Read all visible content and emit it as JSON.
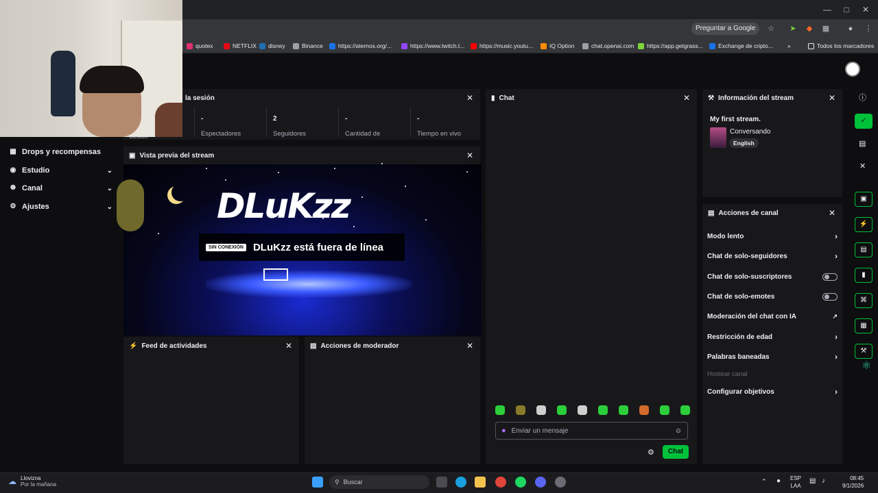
{
  "browser": {
    "ask_google": "Preguntar a Google",
    "bookmarks": [
      {
        "label": "quotex",
        "color": "#e1306c"
      },
      {
        "label": "NETFLIX",
        "color": "#e50914"
      },
      {
        "label": "disney",
        "color": "#1f6fb2"
      },
      {
        "label": "Binance",
        "color": "#9aa0a6"
      },
      {
        "label": "https://aternos.org/...",
        "color": "#1a73e8"
      },
      {
        "label": "https://www.twitch.t...",
        "color": "#9146ff"
      },
      {
        "label": "https://music.youtu...",
        "color": "#ff0000"
      },
      {
        "label": "IQ Option",
        "color": "#ff8c00"
      },
      {
        "label": "chat.openai.com",
        "color": "#9aa0a6"
      },
      {
        "label": "https://app.getgrass...",
        "color": "#7cd53b"
      },
      {
        "label": "Exchange de cripto...",
        "color": "#1a73e8"
      }
    ],
    "all_bookmarks": "Todos los marcadores"
  },
  "sidebar": {
    "items": [
      {
        "label": "Drops y recompensas",
        "icon": "gift-icon"
      },
      {
        "label": "Estudio",
        "icon": "studio-icon"
      },
      {
        "label": "Canal",
        "icon": "channel-icon"
      },
      {
        "label": "Ajustes",
        "icon": "gear-icon"
      }
    ]
  },
  "session": {
    "title": "la sesión",
    "cut_label": "Sesión",
    "stats": [
      {
        "value": "-",
        "label": "Espectadores"
      },
      {
        "value": "2",
        "label": "Seguidores"
      },
      {
        "value": "-",
        "label": "Cantidad de"
      },
      {
        "value": "-",
        "label": "Tiempo en vivo"
      }
    ]
  },
  "preview": {
    "title": "Vista previa del stream",
    "logo": "DLuKzz",
    "offline_badge": "SIN CONEXIÓN",
    "offline_text": "DLuKzz está fuera de línea"
  },
  "activity": {
    "title": "Feed de actividades"
  },
  "moderator": {
    "title": "Acciones de moderador"
  },
  "chat": {
    "title": "Chat",
    "placeholder": "Enviar un mensaje",
    "send_label": "Chat"
  },
  "stream_info": {
    "title": "Información del stream",
    "stream_title": "My first stream.",
    "category": "Conversando",
    "language": "English"
  },
  "channel_actions": {
    "title": "Acciones de canal",
    "items": [
      {
        "label": "Modo lento",
        "control": "arrow"
      },
      {
        "label": "Chat de solo-seguidores",
        "control": "arrow"
      },
      {
        "label": "Chat de solo-suscriptores",
        "control": "toggle"
      },
      {
        "label": "Chat de solo-emotes",
        "control": "toggle"
      },
      {
        "label": "Moderación del chat con IA",
        "control": "external"
      },
      {
        "label": "Restricción de edad",
        "control": "arrow"
      },
      {
        "label": "Palabras baneadas",
        "control": "arrow"
      },
      {
        "label": "Hostear canal",
        "control": "none"
      },
      {
        "label": "Configurar objetivos",
        "control": "arrow"
      }
    ]
  },
  "taskbar": {
    "weather_name": "Llovizna",
    "weather_sub": "Por la mañana",
    "search": "Buscar",
    "lang_top": "ESP",
    "lang_bottom": "LAA",
    "time": "08:45",
    "date": "9/1/2026"
  },
  "colors": {
    "accent": "#00c23a",
    "panel": "#18181b",
    "bg": "#0e0e10"
  }
}
